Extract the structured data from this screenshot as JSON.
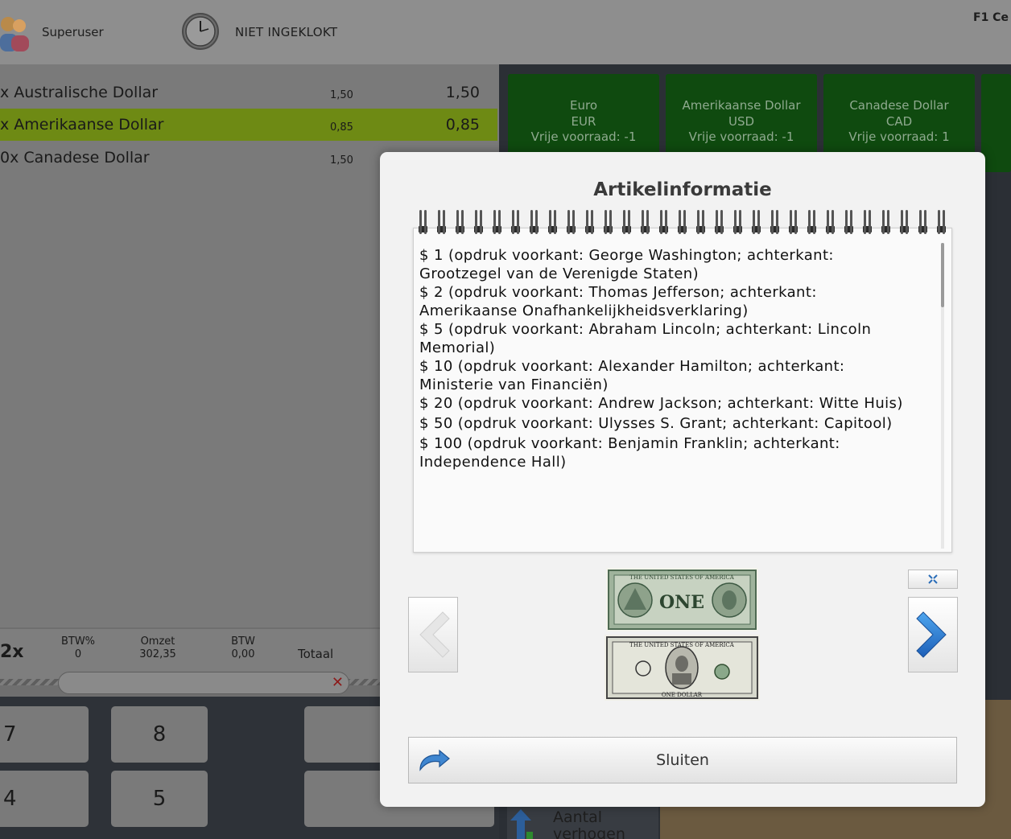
{
  "header": {
    "user_label": "Superuser",
    "clock_label": "NIET INGEKLOKT",
    "top_right_text": "F1 Ce"
  },
  "ticket": {
    "rows": [
      {
        "name": "x Australische Dollar",
        "unit_price": "1,50",
        "total": "1,50",
        "selected": false
      },
      {
        "name": "x Amerikaanse Dollar",
        "unit_price": "0,85",
        "total": "0,85",
        "selected": true
      },
      {
        "name": "0x Canadese Dollar",
        "unit_price": "1,50",
        "total": "",
        "selected": false
      }
    ],
    "summary": {
      "qty_fragment": "2x",
      "btw_pct_label": "BTW%",
      "btw_pct_value": "0",
      "omzet_label": "Omzet",
      "omzet_value": "302,35",
      "btw_label": "BTW",
      "btw_value": "0,00",
      "totaal_label": "Totaal"
    }
  },
  "keypad": {
    "keys": [
      "7",
      "8",
      "4",
      "5"
    ]
  },
  "currency_tiles": [
    {
      "name": "Euro",
      "code": "EUR",
      "stock": "Vrije voorraad: -1"
    },
    {
      "name": "Amerikaanse Dollar",
      "code": "USD",
      "stock": "Vrije voorraad: -1"
    },
    {
      "name": "Canadese Dollar",
      "code": "CAD",
      "stock": "Vrije voorraad: 1"
    }
  ],
  "aantal_button": {
    "line1": "Aantal",
    "line2": "verhogen"
  },
  "modal": {
    "title": "Artikelinformatie",
    "lines": [
      "$ 1 (opdruk voorkant: George Washington; achterkant:",
      "Grootzegel van de Verenigde Staten)",
      "$ 2 (opdruk voorkant: Thomas Jefferson; achterkant:",
      "Amerikaanse Onafhankelijkheidsverklaring)",
      "$ 5 (opdruk voorkant: Abraham Lincoln; achterkant: Lincoln",
      "Memorial)",
      "$ 10 (opdruk voorkant: Alexander Hamilton; achterkant:",
      "Ministerie van Financiën)",
      "$ 20 (opdruk voorkant: Andrew Jackson; achterkant: Witte Huis)",
      "$ 50 (opdruk voorkant: Ulysses S. Grant; achterkant: Capitool)",
      "$ 100 (opdruk voorkant: Benjamin Franklin; achterkant:",
      "Independence Hall)"
    ],
    "bill_front_text": "THE UNITED STATES OF AMERICA",
    "bill_front_value": "ONE",
    "bill_back_text": "THE UNITED STATES OF AMERICA",
    "bill_back_value": "ONE DOLLAR",
    "close_label": "Sluiten"
  }
}
